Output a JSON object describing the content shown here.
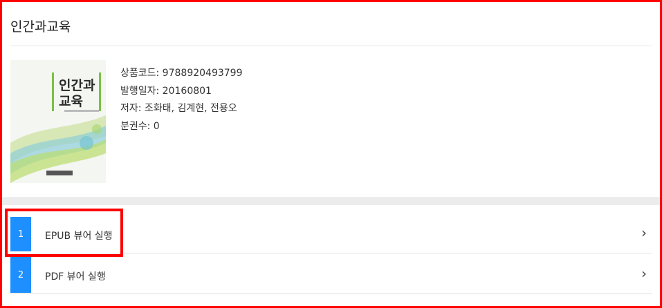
{
  "header": {
    "title": "인간과교육"
  },
  "book": {
    "cover": {
      "title_line1": "인간과",
      "title_line2": "교육",
      "accent": "#7ac143"
    },
    "product_code": "상품코드: 9788920493799",
    "publish_date": "발행일자: 20160801",
    "authors": "저자: 조화태, 김계현, 전용오",
    "volumes": "분권수: 0"
  },
  "actions": [
    {
      "index": "1",
      "label": "EPUB 뷰어 실행",
      "icon": "chevron-right-icon"
    },
    {
      "index": "2",
      "label": "PDF 뷰어 실행",
      "icon": "chevron-right-icon"
    }
  ],
  "colors": {
    "accent": "#1e8fff",
    "highlight": "#ff0000"
  }
}
